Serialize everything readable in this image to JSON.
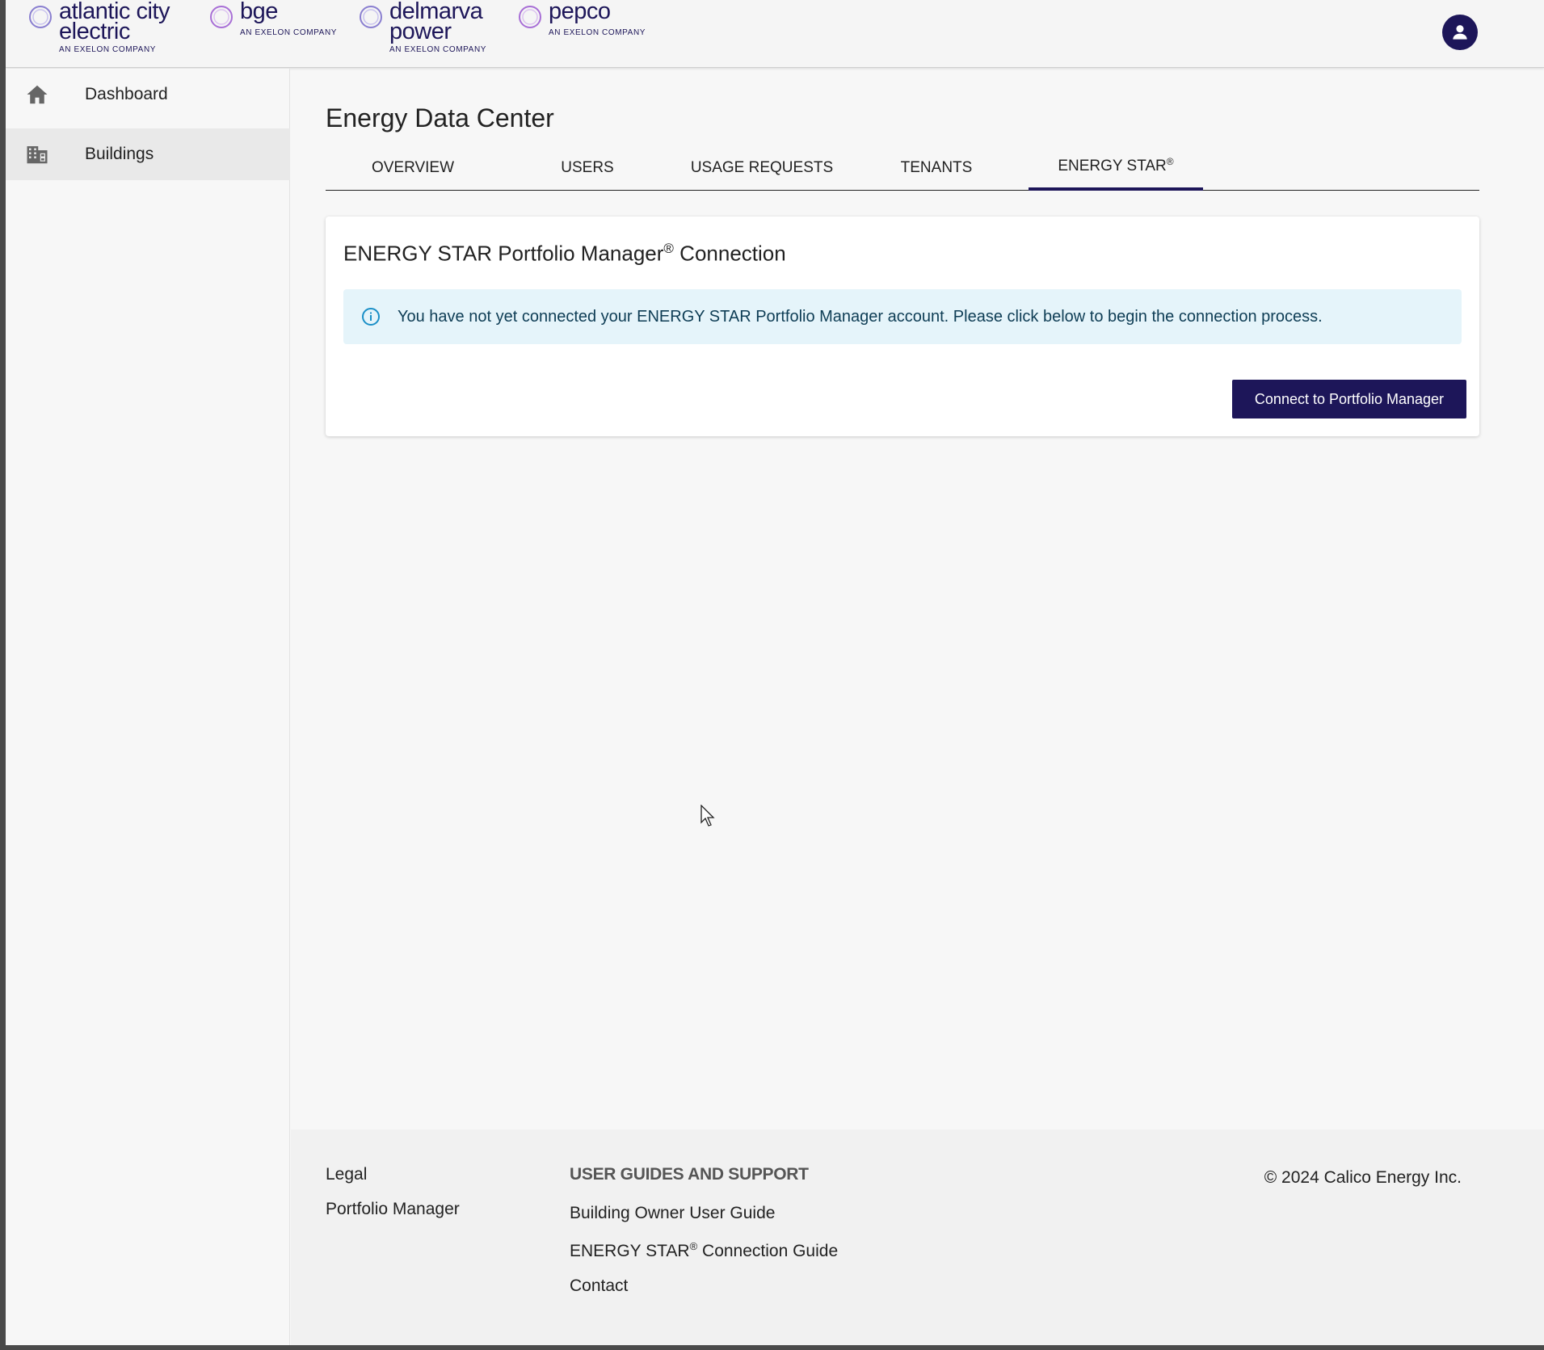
{
  "header": {
    "brands": [
      {
        "line1": "atlantic city",
        "line2": "electric",
        "sub": "AN EXELON COMPANY"
      },
      {
        "line1": "bge",
        "line2": "",
        "sub": "AN EXELON COMPANY"
      },
      {
        "line1": "delmarva",
        "line2": "power",
        "sub": "AN EXELON COMPANY"
      },
      {
        "line1": "pepco",
        "line2": "",
        "sub": "AN EXELON COMPANY"
      }
    ],
    "user_icon": "account-circle-icon"
  },
  "sidebar": {
    "items": [
      {
        "label": "Dashboard",
        "icon": "home-icon",
        "active": false
      },
      {
        "label": "Buildings",
        "icon": "building-icon",
        "active": true
      }
    ]
  },
  "main": {
    "title": "Energy Data Center",
    "tabs": [
      {
        "label": "OVERVIEW"
      },
      {
        "label": "USERS"
      },
      {
        "label": "USAGE REQUESTS"
      },
      {
        "label": "TENANTS"
      },
      {
        "label": "ENERGY STAR",
        "sup": "®",
        "active": true
      }
    ],
    "card": {
      "title_pre": "ENERGY STAR Portfolio Manager",
      "title_sup": "®",
      "title_post": " Connection",
      "alert_message": "You have not yet connected your ENERGY STAR Portfolio Manager account. Please click below to begin the connection process.",
      "button_label": "Connect to Portfolio Manager"
    }
  },
  "footer": {
    "links_left": [
      "Legal",
      "Portfolio Manager"
    ],
    "guides_heading": "USER GUIDES AND SUPPORT",
    "guide_1": "Building Owner User Guide",
    "guide_2_pre": "ENERGY STAR",
    "guide_2_sup": "®",
    "guide_2_post": " Connection Guide",
    "guide_3": "Contact",
    "copyright": "© 2024 Calico Energy Inc."
  },
  "colors": {
    "brand_navy": "#1d1659",
    "alert_bg": "#e5f4fa",
    "alert_icon": "#1a8fc7"
  }
}
